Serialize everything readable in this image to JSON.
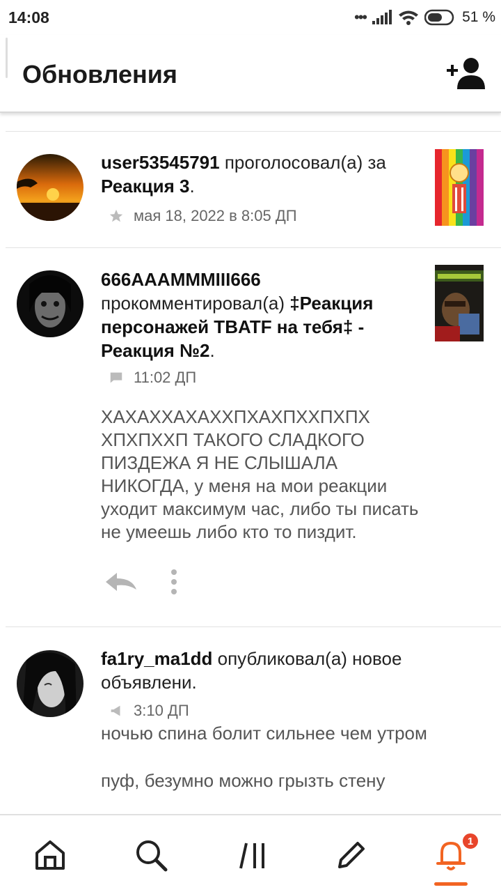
{
  "status_bar": {
    "time": "14:08",
    "battery": "51 %",
    "icons": [
      "signal-icon",
      "wifi-icon",
      "battery-icon"
    ]
  },
  "header": {
    "title": "Обновления",
    "action_icon": "add-user-icon"
  },
  "feed": [
    {
      "user": "user53545791",
      "action": " проголосовал(а) за ",
      "target": "Реакция 3",
      "suffix": ".",
      "meta_icon": "star-icon",
      "timestamp": "мая 18, 2022 в 8:05 ДП"
    },
    {
      "user": "666AAAMMMIII666",
      "action": "прокомментировал(а) ",
      "target": "‡Реакция персонажей TBATF на тебя‡ - Реакция №2",
      "suffix": ".",
      "meta_icon": "comment-icon",
      "timestamp": "11:02 ДП",
      "comment": "ХАХАХХАХАХХПХАХПХХПХПХ ХПХПХХП ТАКОГО СЛАДКОГО ПИЗДЕЖА Я НЕ СЛЫШАЛА НИКОГДА, у меня на мои реакции уходит максимум час, либо ты писать не умеешь либо кто то пиздит.",
      "actions": [
        "reply-icon",
        "more-icon"
      ]
    },
    {
      "user": "fa1ry_ma1dd",
      "action": " опубликовал(а) новое объявлени.",
      "meta_icon": "megaphone-icon",
      "timestamp": "3:10 ДП",
      "text_line1": "ночью спина болит сильнее чем утром",
      "text_line2": "пуф, безумно можно грызть стену"
    }
  ],
  "bottom_nav": {
    "items": [
      "home-icon",
      "search-icon",
      "library-icon",
      "write-icon",
      "notifications-icon"
    ],
    "active": "notifications-icon",
    "notification_count": "1",
    "accent_color": "#f26422"
  }
}
